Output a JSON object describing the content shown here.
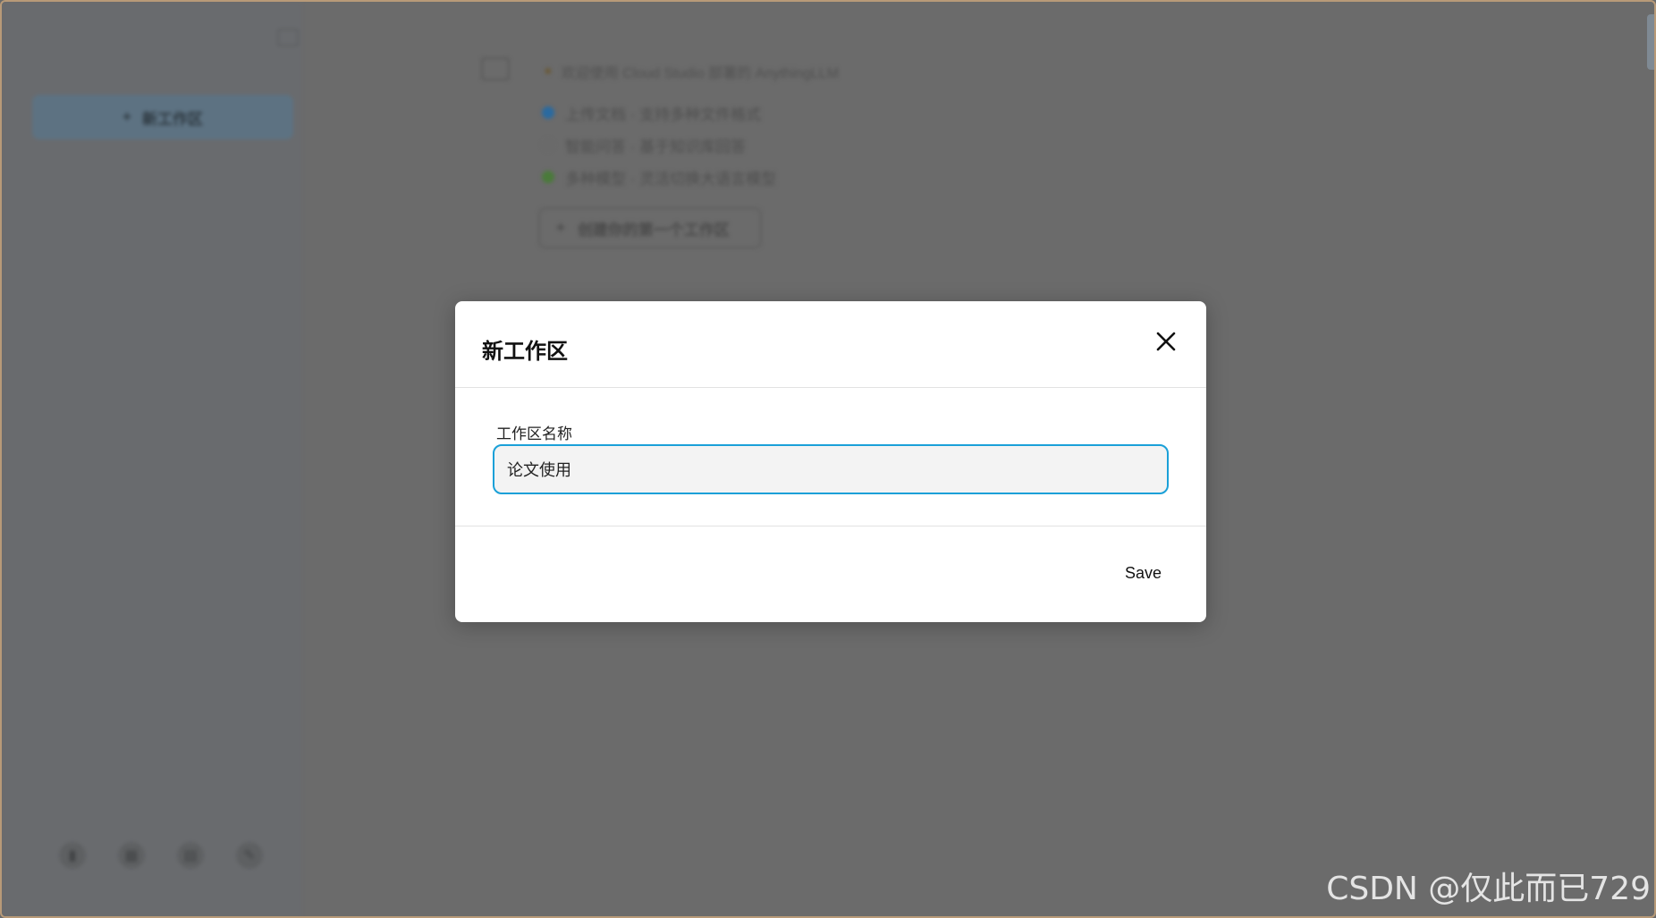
{
  "sidebar": {
    "new_workspace_label": "新工作区",
    "footer_icons": [
      "book-icon",
      "grid-icon",
      "chat-icon",
      "wrench-icon"
    ]
  },
  "main": {
    "announcement": "欢迎使用 Cloud Studio 部署的 AnythingLLM",
    "features": [
      {
        "label": "上传文档 · 支持多种文件格式",
        "color": "#2a6aa0"
      },
      {
        "label": "智能问答 · 基于知识库回答",
        "color": "#6a6a6a"
      },
      {
        "label": "多种模型 · 灵活切换大语言模型",
        "color": "#4a7a3a"
      }
    ],
    "create_first_label": "创建你的第一个工作区"
  },
  "modal": {
    "title": "新工作区",
    "field_label": "工作区名称",
    "input_value": "论文使用",
    "save_label": "Save"
  },
  "watermark": "CSDN @仅此而已729"
}
